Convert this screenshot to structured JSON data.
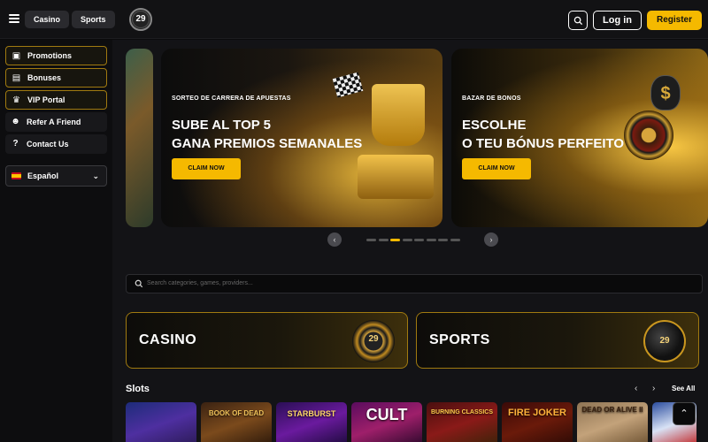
{
  "header": {
    "nav_tabs": [
      "Casino",
      "Sports"
    ],
    "logo_text": "29",
    "login_label": "Log in",
    "register_label": "Register"
  },
  "sidebar": {
    "items": [
      {
        "label": "Promotions",
        "icon": "promotions-icon"
      },
      {
        "label": "Bonuses",
        "icon": "gift-icon"
      },
      {
        "label": "VIP Portal",
        "icon": "crown-icon"
      },
      {
        "label": "Refer A Friend",
        "icon": "users-icon"
      },
      {
        "label": "Contact Us",
        "icon": "help-icon"
      }
    ],
    "language": "Español"
  },
  "banners": [
    {
      "subtitle": "SORTEO DE CARRERA DE APUESTAS",
      "title_line1": "SUBE AL TOP 5",
      "title_line2": "GANA PREMIOS SEMANALES",
      "cta": "CLAIM NOW"
    },
    {
      "subtitle": "BAZAR DE BONOS",
      "title_line1": "ESCOLHE",
      "title_line2": "O TEU BÓNUS PERFEITO",
      "cta": "CLAIM NOW"
    }
  ],
  "carousel": {
    "dot_count": 8,
    "active_index": 2
  },
  "search": {
    "placeholder": "Search categories, games, providers..."
  },
  "category_tiles": [
    {
      "label": "CASINO",
      "badge": "29"
    },
    {
      "label": "SPORTS",
      "badge": "29"
    }
  ],
  "slots": {
    "title": "Slots",
    "see_all_label": "See All",
    "games": [
      "",
      "BOOK OF DEAD",
      "STARBURST",
      "CULT",
      "BURNING CLASSICS",
      "FIRE JOKER",
      "DEAD OR ALIVE II",
      ""
    ]
  },
  "colors": {
    "accent": "#f5b900",
    "background": "#131316",
    "sidebar_bg": "#0d0d0f"
  }
}
